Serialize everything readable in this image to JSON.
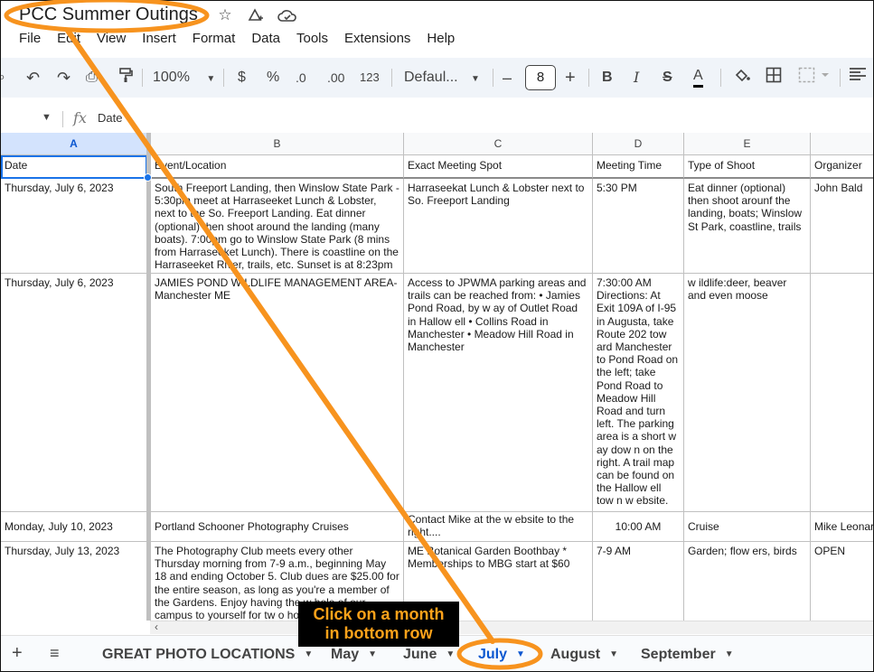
{
  "doc": {
    "title": "PCC Summer Outings"
  },
  "menu": [
    "File",
    "Edit",
    "View",
    "Insert",
    "Format",
    "Data",
    "Tools",
    "Extensions",
    "Help"
  ],
  "toolbar": {
    "zoom": "100%",
    "currency": "$",
    "percent": "%",
    "dec_decrease": ".0",
    "dec_increase": ".00",
    "number_format": "123",
    "font": "Defaul...",
    "font_size": "8",
    "minus": "–",
    "plus": "+",
    "bold": "B",
    "italic": "I",
    "text_color": "A"
  },
  "formula_bar": {
    "fx": "fx",
    "value": "Date"
  },
  "columns": [
    "A",
    "B",
    "C",
    "D",
    "E"
  ],
  "headers": {
    "a": "Date",
    "b": "Event/Location",
    "c": "Exact Meeting Spot",
    "d": "Meeting Time",
    "e": "Type of Shoot",
    "f": "Organizer"
  },
  "rows": [
    {
      "date": "Thursday, July 6, 2023",
      "event": "South Freeport Landing, then Winslow  State Park - 5:30pm meet at Harraseeket Lunch & Lobster, next to the So. Freeport Landing.  Eat dinner (optional) then shoot around the landing (many boats).  7:00pm go to Winslow  State Park (8 mins from Harraseeket Lunch).  There is coastline on the Harraseeket River, trails, etc.  Sunset is at 8:23pm",
      "spot": "Harraseekat Lunch & Lobster next to So. Freeport Landing",
      "time": "5:30 PM",
      "type": "Eat dinner (optional) then shoot arounf the landing, boats; Winslow  St Park, coastline, trails",
      "organizer": "John Bald"
    },
    {
      "date": "Thursday, July 6, 2023",
      "event": "JAMIES POND WILDLIFE MANAGEMENT AREA-Manchester ME",
      "spot": "Access to JPWMA parking areas and trails can be reached from: • Jamies Pond Road, by w ay of Outlet Road in Hallow ell • Collins Road in Manchester • Meadow  Hill Road in Manchester",
      "time": "7:30:00 AM Directions: At Exit 109A of I-95 in Augusta, take Route 202 tow ard Manchester to Pond Road on the left; take Pond Road to Meadow Hill Road and turn left. The parking area is a short w ay dow n on the right. A trail map can be found on the Hallow ell tow n w ebsite.",
      "type": "w ildlife:deer, beaver and even moose",
      "organizer": ""
    },
    {
      "date": "Monday, July 10, 2023",
      "event": "Portland Schooner Photography Cruises",
      "spot": "Contact Mike at the w ebsite to the right....",
      "time": "10:00 AM",
      "type": "Cruise",
      "organizer": "Mike Leonard"
    },
    {
      "date": "Thursday, July 13, 2023",
      "event": "The Photography Club meets every other Thursday morning from 7-9 a.m., beginning May 18 and ending October 5. Club dues are $25.00 for the entire season, as long as you're a member of the Gardens. Enjoy having the w hole of our campus to yourself for tw o hours before",
      "spot": "ME Botanical Garden Boothbay * Memberships to MBG start at $60",
      "time": "7-9 AM",
      "type": "Garden; flow ers, birds",
      "organizer": "OPEN"
    }
  ],
  "sheets": {
    "add": "+",
    "all": "≡",
    "tabs": [
      "GREAT PHOTO LOCATIONS",
      "May",
      "June",
      "July",
      "August",
      "September"
    ],
    "active": "July"
  },
  "annotation": {
    "line1": "Click on a month",
    "line2": "in bottom row",
    "color": "#f7931e"
  }
}
